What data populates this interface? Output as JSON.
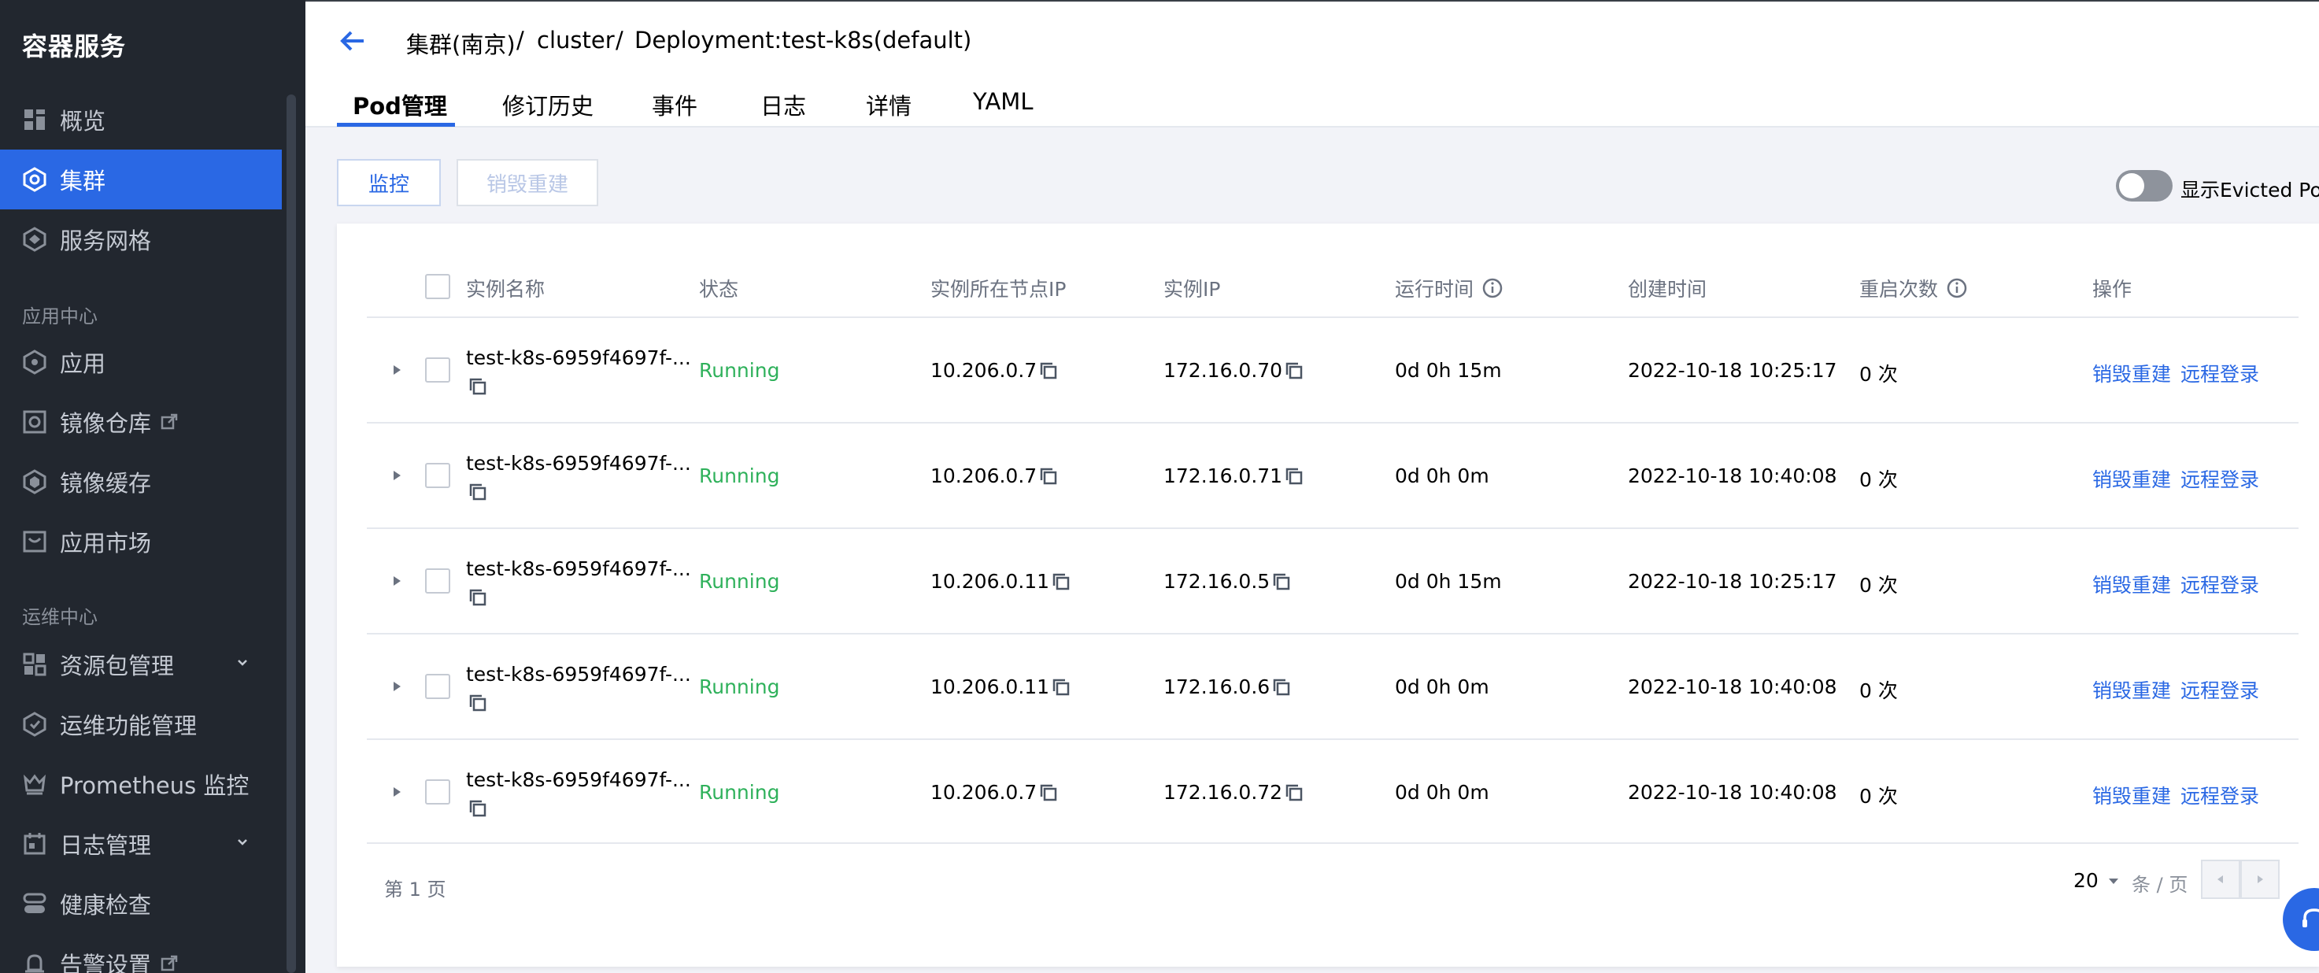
{
  "sidebar": {
    "title": "容器服务",
    "items": [
      {
        "label": "概览",
        "icon": "grid-icon"
      },
      {
        "label": "集群",
        "icon": "cluster-icon",
        "active": true
      },
      {
        "label": "服务网格",
        "icon": "mesh-icon"
      },
      {
        "label": "应用",
        "icon": "app-icon"
      },
      {
        "label": "镜像仓库",
        "icon": "registry-icon",
        "external": true
      },
      {
        "label": "镜像缓存",
        "icon": "cache-icon"
      },
      {
        "label": "应用市场",
        "icon": "market-icon"
      },
      {
        "label": "资源包管理",
        "icon": "package-icon",
        "expandable": true
      },
      {
        "label": "运维功能管理",
        "icon": "ops-icon"
      },
      {
        "label": "Prometheus 监控",
        "icon": "prometheus-icon"
      },
      {
        "label": "日志管理",
        "icon": "log-icon",
        "expandable": true
      },
      {
        "label": "健康检查",
        "icon": "health-icon"
      },
      {
        "label": "告警设置",
        "icon": "alarm-icon",
        "external": true
      }
    ],
    "groups": {
      "app_center": "应用中心",
      "ops_center": "运维中心"
    }
  },
  "header": {
    "breadcrumb": [
      "集群(南京)",
      "cluster",
      "Deployment:test-k8s(default)"
    ],
    "separator": "/",
    "tabs": [
      "Pod管理",
      "修订历史",
      "事件",
      "日志",
      "详情",
      "YAML"
    ],
    "active_tab": "Pod管理"
  },
  "toolbar": {
    "monitor_label": "监控",
    "destroy_rebuild_label": "销毁重建",
    "toggle_label": "显示Evicted Pod",
    "toggle_on": false
  },
  "table": {
    "columns": [
      "实例名称",
      "状态",
      "实例所在节点IP",
      "实例IP",
      "运行时间",
      "创建时间",
      "重启次数",
      "操作"
    ],
    "rows": [
      {
        "name": "test-k8s-6959f4697f-...",
        "status": "Running",
        "node_ip": "10.206.0.7",
        "pod_ip": "172.16.0.70",
        "uptime": "0d 0h 15m",
        "created": "2022-10-18 10:25:17",
        "restarts": "0 次",
        "action1": "销毁重建",
        "action2": "远程登录"
      },
      {
        "name": "test-k8s-6959f4697f-...",
        "status": "Running",
        "node_ip": "10.206.0.7",
        "pod_ip": "172.16.0.71",
        "uptime": "0d 0h 0m",
        "created": "2022-10-18 10:40:08",
        "restarts": "0 次",
        "action1": "销毁重建",
        "action2": "远程登录"
      },
      {
        "name": "test-k8s-6959f4697f-...",
        "status": "Running",
        "node_ip": "10.206.0.11",
        "pod_ip": "172.16.0.5",
        "uptime": "0d 0h 15m",
        "created": "2022-10-18 10:25:17",
        "restarts": "0 次",
        "action1": "销毁重建",
        "action2": "远程登录"
      },
      {
        "name": "test-k8s-6959f4697f-...",
        "status": "Running",
        "node_ip": "10.206.0.11",
        "pod_ip": "172.16.0.6",
        "uptime": "0d 0h 0m",
        "created": "2022-10-18 10:40:08",
        "restarts": "0 次",
        "action1": "销毁重建",
        "action2": "远程登录"
      },
      {
        "name": "test-k8s-6959f4697f-...",
        "status": "Running",
        "node_ip": "10.206.0.7",
        "pod_ip": "172.16.0.72",
        "uptime": "0d 0h 0m",
        "created": "2022-10-18 10:40:08",
        "restarts": "0 次",
        "action1": "销毁重建",
        "action2": "远程登录"
      }
    ]
  },
  "pagination": {
    "page_text": "第 1 页",
    "page_size": "20",
    "per_page_label": "条 / 页"
  },
  "colors": {
    "sidebar_bg": "#22272f",
    "accent": "#2a68e4",
    "running": "#2fb15b"
  }
}
